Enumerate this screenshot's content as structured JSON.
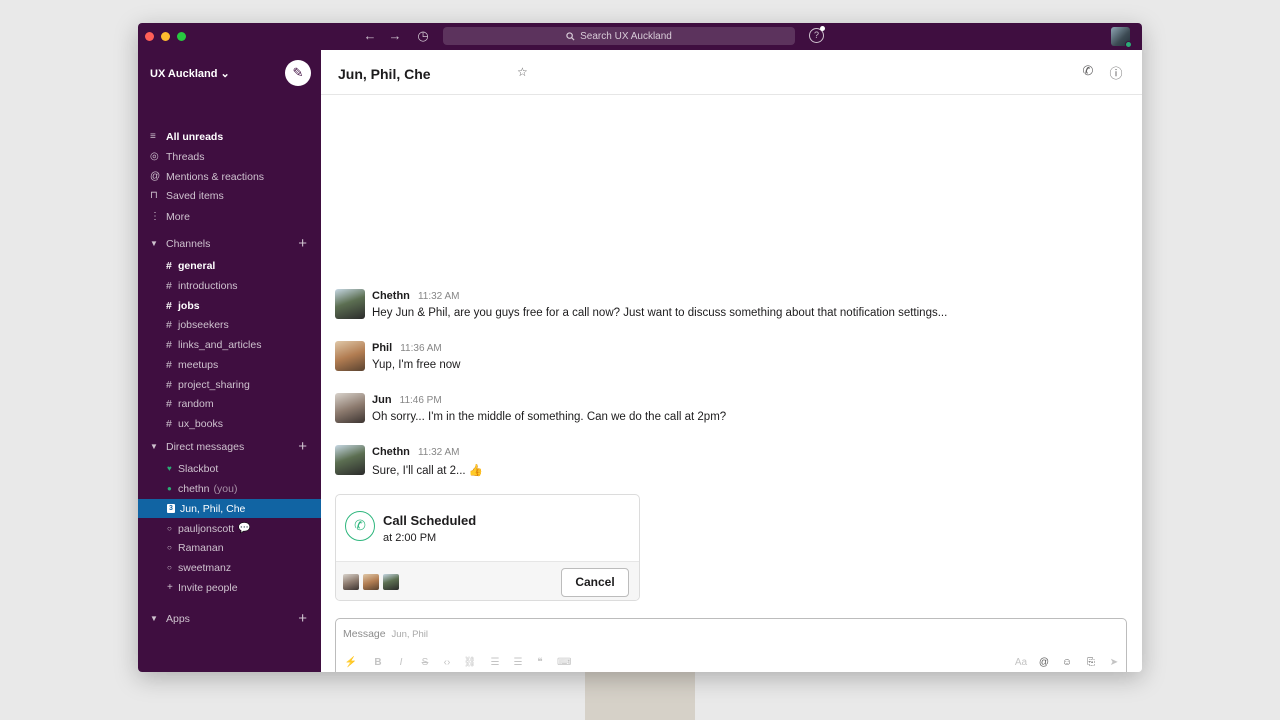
{
  "topbar": {
    "back_icon": "←",
    "forward_icon": "→",
    "history_icon": "◷",
    "search_placeholder": "Search UX Auckland",
    "help_icon": "?"
  },
  "sidebar": {
    "workspace_name": "UX Auckland ⌄",
    "compose_icon": "✎",
    "nav": [
      {
        "icon": "≡",
        "label": "All unreads"
      },
      {
        "icon": "◎",
        "label": "Threads"
      },
      {
        "icon": "@",
        "label": "Mentions & reactions"
      },
      {
        "icon": "⊓",
        "label": "Saved items"
      },
      {
        "icon": "⋮",
        "label": "More"
      }
    ],
    "channels_header": "Channels",
    "channels": [
      {
        "name": "general",
        "bold": true
      },
      {
        "name": "introductions",
        "bold": false
      },
      {
        "name": "jobs",
        "bold": true
      },
      {
        "name": "jobseekers",
        "bold": false
      },
      {
        "name": "links_and_articles",
        "bold": false
      },
      {
        "name": "meetups",
        "bold": false
      },
      {
        "name": "project_sharing",
        "bold": false
      },
      {
        "name": "random",
        "bold": false
      },
      {
        "name": "ux_books",
        "bold": false
      }
    ],
    "dm_header": "Direct messages",
    "dms": {
      "slackbot": "Slackbot",
      "chethn": "chethn",
      "chethn_you": "(you)",
      "group_count": "3",
      "group": "Jun, Phil, Che",
      "pauljonscott": "pauljonscott",
      "ramanan": "Ramanan",
      "sweetmanz": "sweetmanz",
      "invite": "Invite people"
    },
    "apps_header": "Apps",
    "plus": "+"
  },
  "channel": {
    "title": "Jun, Phil, Che",
    "star_icon": "☆",
    "phone_icon": "✆",
    "info_icon": "ⓘ"
  },
  "messages": [
    {
      "author": "Chethn",
      "time": "11:32 AM",
      "text": "Hey Jun & Phil, are you guys free for a call now? Just want to discuss something about that notification settings..."
    },
    {
      "author": "Phil",
      "time": "11:36 AM",
      "text": "Yup, I'm free now"
    },
    {
      "author": "Jun",
      "time": "11:46 PM",
      "text": "Oh sorry... I'm in the middle of something. Can we do the call at 2pm?"
    },
    {
      "author": "Chethn",
      "time": "11:32 AM",
      "text": "Sure, I'll call at 2... 👍"
    }
  ],
  "call_card": {
    "title": "Call Scheduled",
    "time": "at 2:00 PM",
    "cancel_label": "Cancel"
  },
  "composer": {
    "placeholder": "Message",
    "recipients": "Jun, Phil"
  },
  "colors": {
    "sidebar": "#3f0e40",
    "active": "#1164a3",
    "presence": "#2bac76",
    "call_green": "#2eb67d"
  }
}
